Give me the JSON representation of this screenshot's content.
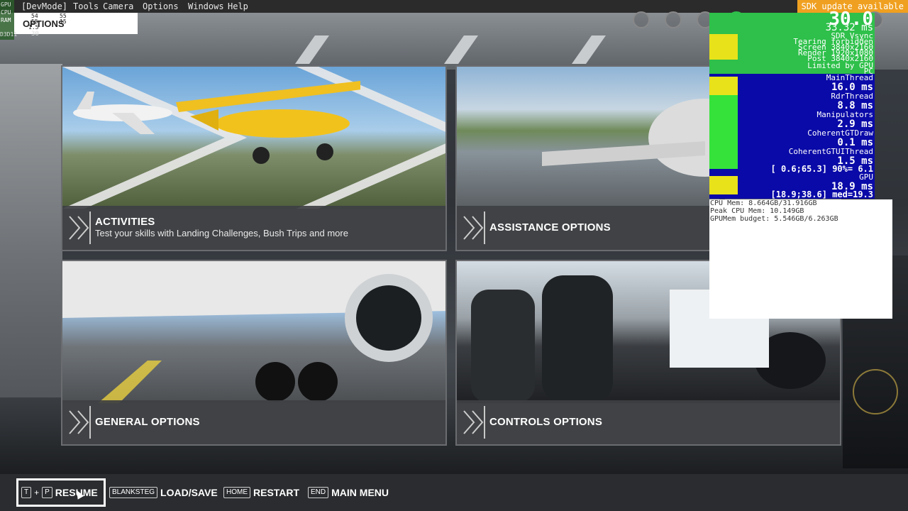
{
  "menubar": {
    "items": [
      "[DevMode]",
      "Tools",
      "Camera",
      "Options",
      "Windows",
      "Help"
    ],
    "sdk_notice": "SDK update available"
  },
  "fps_overlay": {
    "labels": [
      "GPU",
      "CPU",
      "RAM",
      "D3D11"
    ],
    "values_a": [
      "54",
      "55",
      "1.5"
    ],
    "values_b": [
      "55",
      "15",
      "55"
    ],
    "bottom_num": "30"
  },
  "page": {
    "title": "OPTIONS"
  },
  "tiles": [
    {
      "title": "ACTIVITIES",
      "subtitle": "Test your skills with Landing Challenges, Bush Trips and more"
    },
    {
      "title": "ASSISTANCE OPTIONS",
      "subtitle": ""
    },
    {
      "title": "GENERAL OPTIONS",
      "subtitle": ""
    },
    {
      "title": "CONTROLS OPTIONS",
      "subtitle": ""
    }
  ],
  "perf": {
    "fps": "30.0",
    "frame_ms": "33.32 ms",
    "sync": "SDR Vsync",
    "tearing": "Tearing forbidden",
    "screen": "Screen 3840x2160",
    "render": "Render 1920x1080",
    "post": "Post 3840x2160",
    "limited": "Limited by GPU",
    "pc": "PC",
    "rows": [
      {
        "label": "MainThread",
        "value": "16.0 ms",
        "range": ""
      },
      {
        "label": "RdrThread",
        "value": "8.8 ms",
        "range": ""
      },
      {
        "label": "Manipulators",
        "value": "2.9 ms",
        "range": ""
      },
      {
        "label": "CoherentGTDraw",
        "value": "0.1 ms",
        "range": ""
      },
      {
        "label": "CoherentGTUIThread",
        "value": "1.5 ms",
        "range": "[ 0.6;65.3] 90%= 6.1"
      },
      {
        "label": "GPU",
        "value": "18.9 ms",
        "range": "[18.9;38.6] med=19.3"
      }
    ],
    "mem": [
      "CPU Mem: 8.664GB/31.916GB",
      "Peak CPU Mem: 10.149GB",
      "GPUMem budget: 5.546GB/6.263GB"
    ]
  },
  "bottom_bar": {
    "resume": {
      "keys": [
        "T",
        "P"
      ],
      "plus": "+",
      "label": "RESUME"
    },
    "load_save": {
      "key": "BLANKSTEG",
      "label": "LOAD/SAVE"
    },
    "restart": {
      "key": "HOME",
      "label": "RESTART"
    },
    "main_menu": {
      "key": "END",
      "label": "MAIN MENU"
    }
  },
  "colors": {
    "accent": "#ffffff",
    "tile_bar": "#3e4043",
    "perf_bg": "#0a0aa8",
    "perf_green": "#2ec04a",
    "sdk_orange": "#f0a020"
  }
}
